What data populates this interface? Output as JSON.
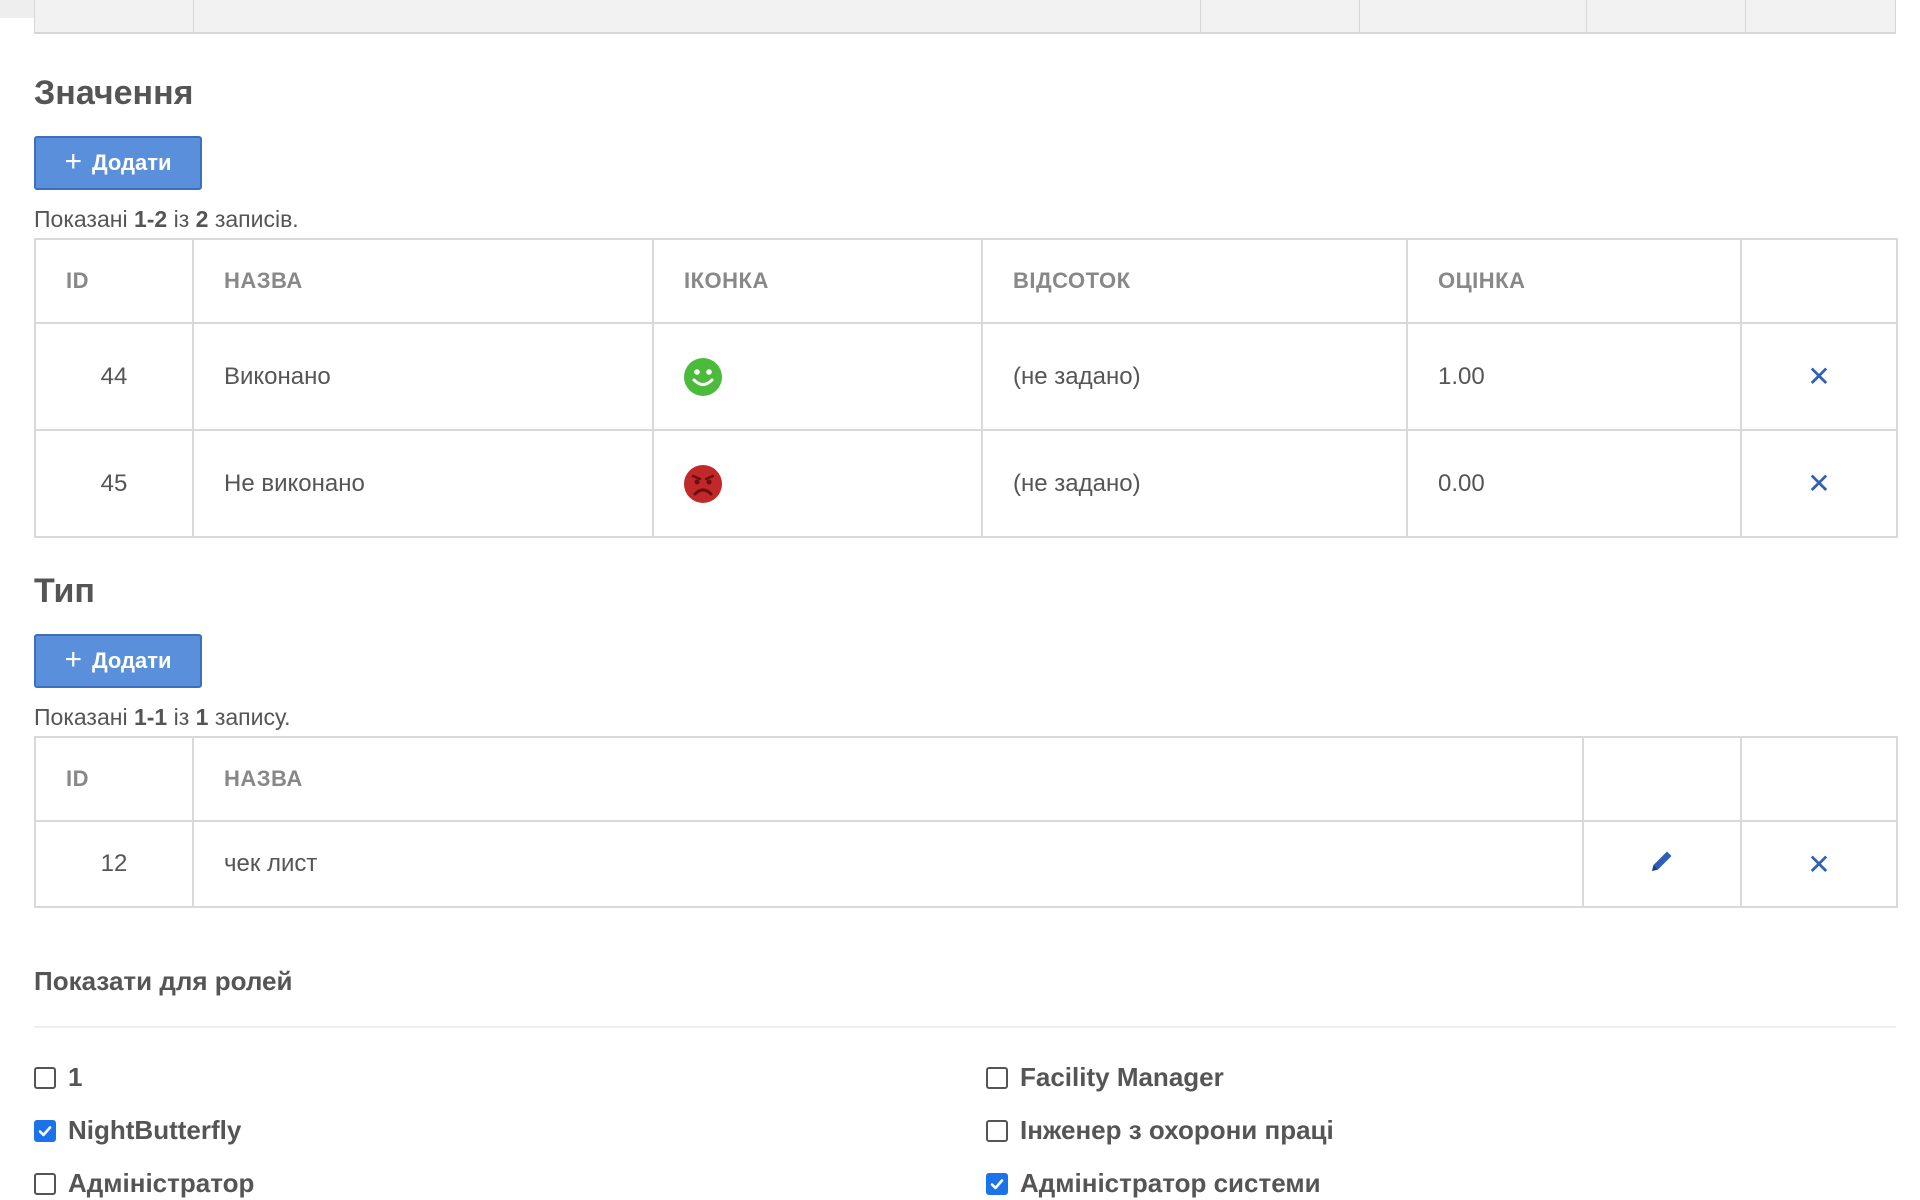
{
  "values_section": {
    "title": "Значення",
    "add_label": "Додати",
    "summary": {
      "prefix": "Показані ",
      "range": "1-2",
      "mid": " із ",
      "total": "2",
      "suffix": " записів."
    },
    "columns": [
      "ID",
      "НАЗВА",
      "ІКОНКА",
      "ВІДСОТОК",
      "ОЦІНКА",
      ""
    ],
    "rows": [
      {
        "id": "44",
        "name": "Виконано",
        "icon": "smile-green-icon",
        "percent": "(не задано)",
        "score": "1.00"
      },
      {
        "id": "45",
        "name": "Не виконано",
        "icon": "frown-red-icon",
        "percent": "(не задано)",
        "score": "0.00"
      }
    ]
  },
  "type_section": {
    "title": "Тип",
    "add_label": "Додати",
    "summary": {
      "prefix": "Показані ",
      "range": "1-1",
      "mid": " із ",
      "total": "1",
      "suffix": " запису."
    },
    "columns": [
      "ID",
      "НАЗВА",
      "",
      ""
    ],
    "rows": [
      {
        "id": "12",
        "name": "чек лист"
      }
    ]
  },
  "roles_section": {
    "title": "Показати для ролей",
    "roles": [
      {
        "label": "1",
        "checked": false
      },
      {
        "label": "Facility Manager",
        "checked": false
      },
      {
        "label": "NightButterfly",
        "checked": true
      },
      {
        "label": "Інженер з охорони праці",
        "checked": false
      },
      {
        "label": "Адміністратор",
        "checked": false
      },
      {
        "label": "Адміністратор системи",
        "checked": true
      }
    ]
  },
  "colors": {
    "button": "#5a8fdb",
    "action_icon": "#2f5fb8",
    "checkbox_on": "#1a73e8",
    "smile_green": "#4cbb3c",
    "frown_red": "#c0282a"
  }
}
